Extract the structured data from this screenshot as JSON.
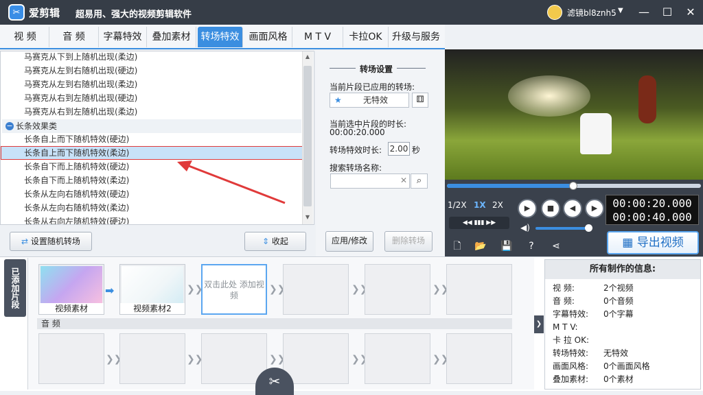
{
  "app": {
    "name": "爱剪辑",
    "slogan": "超易用、强大的视频剪辑软件",
    "user": "滤镜bl8znh5"
  },
  "window_controls": {
    "minimize": "—",
    "maximize": "☐",
    "close": "✕"
  },
  "tabs": [
    "视  频",
    "音  频",
    "字幕特效",
    "叠加素材",
    "转场特效",
    "画面风格",
    "M T V",
    "卡拉OK",
    "升级与服务"
  ],
  "active_tab": "转场特效",
  "effects_list": {
    "items_before": [
      "马赛克从下到上随机出现(柔边)",
      "马赛克从左到右随机出现(硬边)",
      "马赛克从左到右随机出现(柔边)",
      "马赛克从右到左随机出现(硬边)",
      "马赛克从右到左随机出现(柔边)"
    ],
    "category": "长条效果类",
    "items_after": [
      "长条自上而下随机特效(硬边)",
      "长条自上而下随机特效(柔边)",
      "长条自下而上随机特效(硬边)",
      "长条自下而上随机特效(柔边)",
      "长条从左向右随机特效(硬边)",
      "长条从左向右随机特效(柔边)",
      "长条从右向左随机特效(硬边)"
    ],
    "selected": "长条自上而下随机特效(柔边)"
  },
  "random_button": "设置随机转场",
  "collapse_button": "收起",
  "settings": {
    "title": "转场设置",
    "applied_label": "当前片段已应用的转场:",
    "applied_value": "无特效",
    "duration_label": "当前选中片段的时长:",
    "duration_value": "00:00:20.000",
    "effect_duration_label": "转场特效时长:",
    "effect_duration_value": "2.00",
    "seconds_unit": "秒",
    "search_label": "搜索转场名称:",
    "search_value": "",
    "apply_button": "应用/修改",
    "delete_button": "删除转场"
  },
  "player": {
    "speeds": [
      "1/2X",
      "1X",
      "2X"
    ],
    "active_speed": "1X",
    "current_time": "00:00:20.000",
    "total_time": "00:00:40.000",
    "progress": 0.5,
    "volume": 0.95,
    "export_button": "导出视频"
  },
  "timeline": {
    "added_tab": "已添加片段",
    "clips": [
      "视频素材",
      "视频素材2"
    ],
    "add_video_text": "双击此处 添加视频",
    "audio_label": "音 频"
  },
  "info": {
    "title": "所有制作的信息:",
    "rows": [
      {
        "k": "视    频:",
        "v": "2个视频"
      },
      {
        "k": "音    频:",
        "v": "0个音频"
      },
      {
        "k": "字幕特效:",
        "v": "0个字幕"
      },
      {
        "k": "M  T  V:",
        "v": ""
      },
      {
        "k": "卡 拉 OK:",
        "v": ""
      },
      {
        "k": "转场特效:",
        "v": "无特效"
      },
      {
        "k": "画面风格:",
        "v": "0个画面风格"
      },
      {
        "k": "叠加素材:",
        "v": "0个素材"
      }
    ]
  },
  "colors": {
    "accent": "#3b8ee0",
    "titlebar": "#363d47",
    "selection": "#c8e2f8"
  }
}
